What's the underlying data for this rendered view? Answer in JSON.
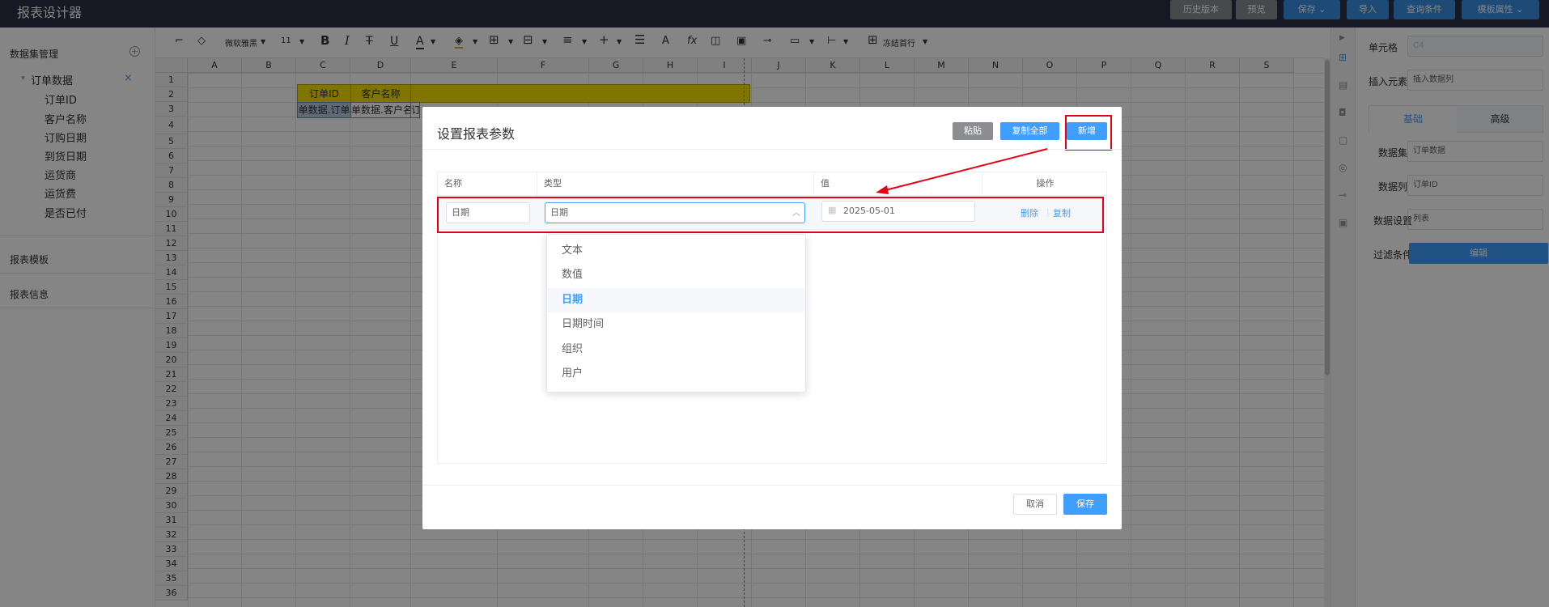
{
  "app": {
    "title": "报表设计器"
  },
  "topbar": {
    "buttons": [
      {
        "label": "历史版本",
        "style": "gray"
      },
      {
        "label": "预览",
        "style": "gray"
      },
      {
        "label": "保存 ⌄",
        "style": "blue"
      },
      {
        "label": "导入",
        "style": "blue"
      },
      {
        "label": "查询条件",
        "style": "blue"
      },
      {
        "label": "模板属性 ⌄",
        "style": "blue"
      }
    ]
  },
  "sidebar": {
    "dataset_title": "数据集管理",
    "dataset_name": "订单数据",
    "fields": [
      "订单ID",
      "客户名称",
      "订购日期",
      "到货日期",
      "运货商",
      "运货费",
      "是否已付"
    ],
    "sections": [
      "报表模板",
      "报表信息"
    ]
  },
  "toolbar": {
    "font": "微软雅黑",
    "size": "11",
    "freeze": "冻结首行"
  },
  "sheet": {
    "columns": [
      "A",
      "B",
      "C",
      "D",
      "E",
      "F",
      "G",
      "H",
      "I",
      "J",
      "K",
      "L",
      "M",
      "N",
      "O",
      "P",
      "Q",
      "R",
      "S"
    ],
    "rows": [
      "1",
      "2",
      "3",
      "4",
      "5",
      "6",
      "7",
      "8",
      "9",
      "10",
      "11",
      "12",
      "13",
      "14",
      "15",
      "16",
      "17",
      "18",
      "19",
      "20",
      "21",
      "22",
      "23",
      "24",
      "25",
      "26",
      "27",
      "28",
      "29",
      "30",
      "31",
      "32",
      "33",
      "34",
      "35",
      "36"
    ],
    "header_cells": [
      "订单ID",
      "客户名称"
    ],
    "data_cells": [
      "单数据.订单",
      "单数据.客户名",
      "订"
    ]
  },
  "right_panel": {
    "cell_label": "单元格",
    "cell_value": "C4",
    "insert_label": "插入元素",
    "insert_value": "插入数据列",
    "tabs": [
      "基础",
      "高级"
    ],
    "dataset_label": "数据集",
    "dataset_value": "订单数据",
    "column_label": "数据列",
    "column_value": "订单ID",
    "setting_label": "数据设置",
    "setting_value": "列表",
    "filter_label": "过滤条件",
    "filter_button": "编辑"
  },
  "dialog": {
    "title": "设置报表参数",
    "paste": "粘贴",
    "copy_all": "复制全部",
    "add": "新增",
    "columns": {
      "name": "名称",
      "type": "类型",
      "value": "值",
      "action": "操作"
    },
    "row": {
      "name": "日期",
      "type": "日期",
      "value": "2025-05-01",
      "delete": "删除",
      "copy": "复制"
    },
    "type_options": [
      "文本",
      "数值",
      "日期",
      "日期时间",
      "组织",
      "用户"
    ],
    "selected_type": "日期",
    "cancel": "取消",
    "save": "保存"
  },
  "colors": {
    "topbar": "#2b3145",
    "accent": "#409eff",
    "highlight": "#e60012",
    "header_fill": "#f5e000"
  }
}
